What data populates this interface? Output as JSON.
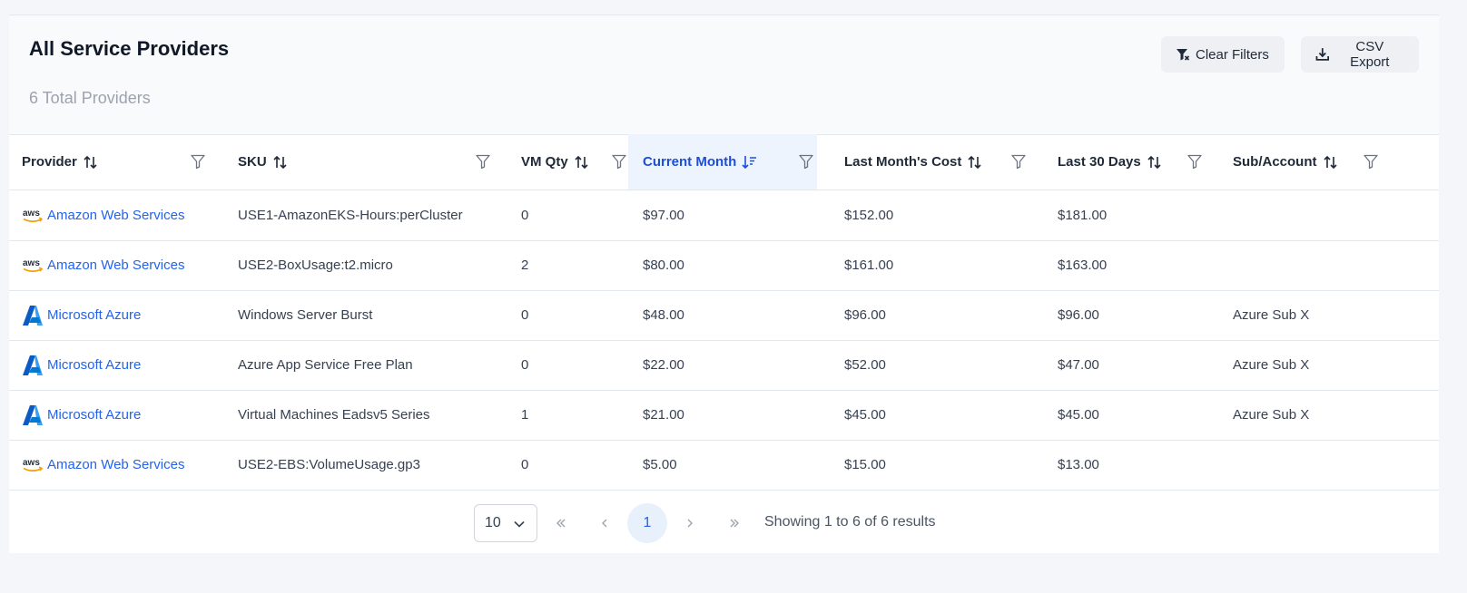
{
  "header": {
    "title": "All Service Providers",
    "subtitle": "6 Total Providers",
    "clear_filters": "Clear Filters",
    "csv_export": "CSV Export"
  },
  "columns": [
    "Provider",
    "SKU",
    "VM Qty",
    "Current Month",
    "Last Month's Cost",
    "Last 30 Days",
    "Sub/Account"
  ],
  "active_sort_column": "Current Month",
  "rows": [
    {
      "logo": "aws-logo-icon",
      "provider": "Amazon Web Services",
      "sku": "USE1-AmazonEKS-Hours:perCluster",
      "qty": "0",
      "current": "$97.00",
      "last_month": "$152.00",
      "last30": "$181.00",
      "sub": ""
    },
    {
      "logo": "aws-logo-icon",
      "provider": "Amazon Web Services",
      "sku": "USE2-BoxUsage:t2.micro",
      "qty": "2",
      "current": "$80.00",
      "last_month": "$161.00",
      "last30": "$163.00",
      "sub": ""
    },
    {
      "logo": "azure-logo-icon",
      "provider": "Microsoft Azure",
      "sku": "Windows Server Burst",
      "qty": "0",
      "current": "$48.00",
      "last_month": "$96.00",
      "last30": "$96.00",
      "sub": "Azure Sub X"
    },
    {
      "logo": "azure-logo-icon",
      "provider": "Microsoft Azure",
      "sku": "Azure App Service Free Plan",
      "qty": "0",
      "current": "$22.00",
      "last_month": "$52.00",
      "last30": "$47.00",
      "sub": "Azure Sub X"
    },
    {
      "logo": "azure-logo-icon",
      "provider": "Microsoft Azure",
      "sku": "Virtual Machines Eadsv5 Series",
      "qty": "1",
      "current": "$21.00",
      "last_month": "$45.00",
      "last30": "$45.00",
      "sub": "Azure Sub X"
    },
    {
      "logo": "aws-logo-icon",
      "provider": "Amazon Web Services",
      "sku": "USE2-EBS:VolumeUsage.gp3",
      "qty": "0",
      "current": "$5.00",
      "last_month": "$15.00",
      "last30": "$13.00",
      "sub": ""
    }
  ],
  "pagination": {
    "page_size": "10",
    "current_page": "1",
    "showing": "Showing 1 to 6 of 6 results"
  },
  "colors": {
    "accent": "#2563eb",
    "active_header_bg": "#eef4fd",
    "aws_orange": "#f59e0b",
    "azure_blue": "#0078d4"
  }
}
